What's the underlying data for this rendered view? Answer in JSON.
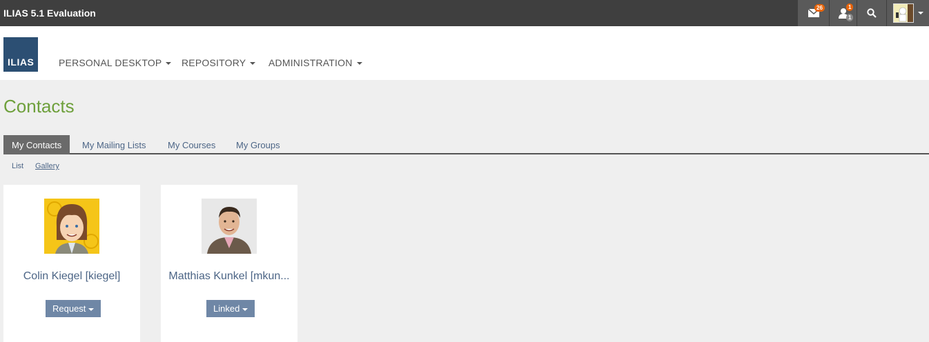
{
  "topbar": {
    "title": "ILIAS 5.1 Evaluation",
    "mail_icon": "envelope-icon",
    "mail_badge": "26",
    "contacts_icon": "user-icon",
    "contacts_badge_new": "1",
    "contacts_badge_total": "1",
    "search_icon": "search-icon"
  },
  "header": {
    "logo_text": "ILIAS",
    "nav": [
      "PERSONAL DESKTOP",
      "REPOSITORY",
      "ADMINISTRATION"
    ]
  },
  "page": {
    "title": "Contacts",
    "tabs": [
      "My Contacts",
      "My Mailing Lists",
      "My Courses",
      "My Groups"
    ],
    "active_tab": "My Contacts",
    "subtabs": [
      "List",
      "Gallery"
    ]
  },
  "contacts": [
    {
      "name": "Colin Kiegel [kiegel]",
      "action": "Request"
    },
    {
      "name": "Matthias Kunkel [mkun...",
      "action": "Linked"
    }
  ],
  "colors": {
    "topbar": "#3f3f3f",
    "accent_green": "#6ea03c",
    "link_blue": "#4c6586",
    "button": "#6f87a6",
    "logo": "#2c4f73",
    "badge": "#e8650a"
  }
}
